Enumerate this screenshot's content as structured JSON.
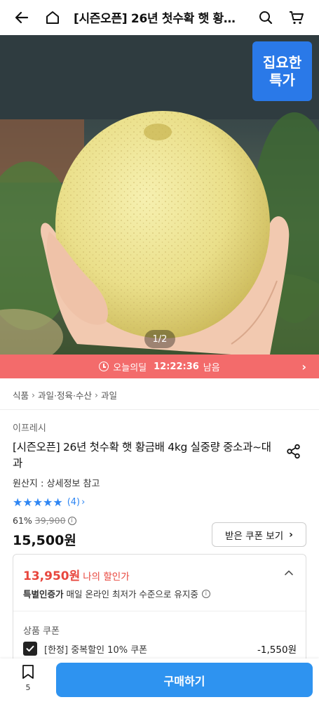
{
  "header": {
    "title": "[시즌오픈] 26년 첫수확 햇 황금배 4kg 실중량 중소과~대과",
    "icons": [
      "back-arrow-icon",
      "home-icon",
      "search-icon",
      "cart-icon"
    ]
  },
  "hero": {
    "badge_line1": "집요한",
    "badge_line2": "특가",
    "pager": "1/2"
  },
  "timer": {
    "label": "오늘의딜",
    "time": "12:22:36",
    "suffix": "남음"
  },
  "breadcrumb": {
    "items": [
      "식품",
      "과일·정육·수산",
      "과일"
    ]
  },
  "product": {
    "brand": "이프레시",
    "title": "[시즌오픈] 26년 첫수확 햇 황금배 4kg 실중량 중소과~대과",
    "origin": "원산지 : 상세정보 참고",
    "rating": 5,
    "stars": "★★★★★",
    "review_count": "(4)",
    "discount_rate": "61%",
    "original_price": "39,900",
    "price": "15,500원",
    "coupon_button": "받은 쿠폰 보기"
  },
  "discount_box": {
    "my_price": "13,950원",
    "my_price_label": "나의 할인가",
    "special_label": "특별인증가",
    "special_text": "매일 온라인 최저가 수준으로 유지중",
    "section_title": "상품 쿠폰",
    "coupon_name": "[한정] 중복할인 10% 쿠폰",
    "coupon_amount": "-1,550원"
  },
  "bottom_bar": {
    "wish_count": "5",
    "buy_label": "구매하기"
  },
  "colors": {
    "accent_blue": "#2e93f0",
    "timer_red": "#f36b6b",
    "discount_red": "#e8473e",
    "badge_blue": "#2a79e8"
  }
}
